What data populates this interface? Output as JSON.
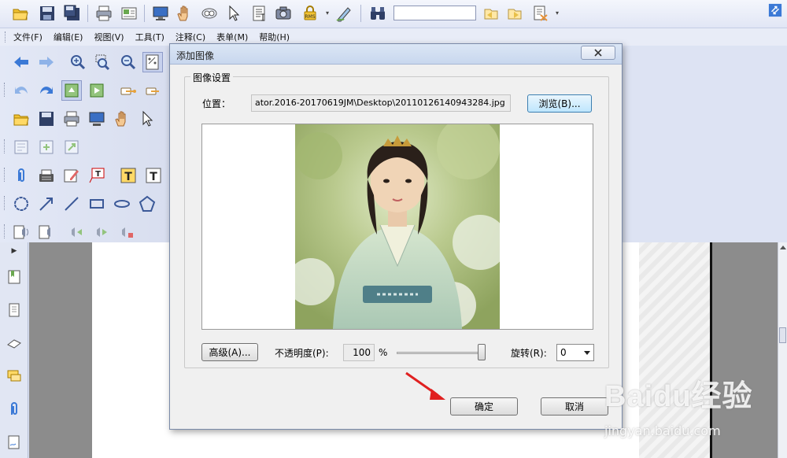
{
  "menu": [
    "文件(F)",
    "编辑(E)",
    "视图(V)",
    "工具(T)",
    "注释(C)",
    "表单(M)",
    "帮助(H)"
  ],
  "toolbar": {
    "find_value": "",
    "rms_label": "RMS"
  },
  "dialog": {
    "title": "添加图像",
    "group_label": "图像设置",
    "location_label": "位置：",
    "location_value": "ator.2016-20170619JM\\Desktop\\20110126140943284.jpg",
    "browse_label": "浏览(B)...",
    "advanced_label": "高级(A)...",
    "opacity_label": "不透明度(P):",
    "opacity_value": "100",
    "opacity_unit": "%",
    "opacity_slider_percent": 100,
    "rotate_label": "旋转(R):",
    "rotate_value": "0",
    "ok_label": "确定",
    "cancel_label": "取消"
  },
  "watermark": {
    "logo": "Baidu经验",
    "sub": "jingyan.baidu.com"
  },
  "colors": {
    "accent_blue": "#2b6cc4",
    "annotation_red": "#e02020",
    "button_focus_border": "#3c7fb1"
  }
}
